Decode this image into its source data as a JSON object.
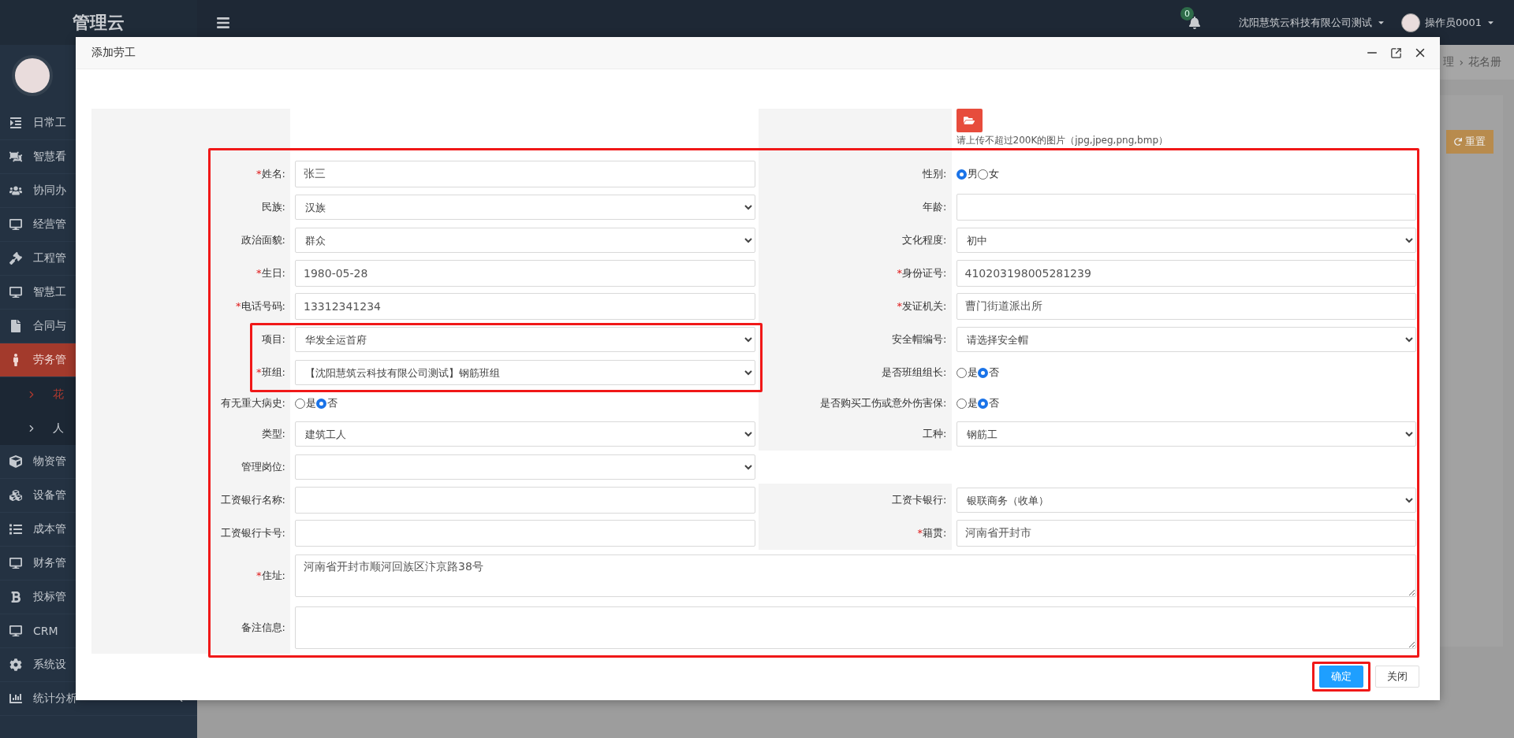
{
  "app": {
    "title": "管理云",
    "notifications": "0",
    "company": "沈阳慧筑云科技有限公司测试",
    "user": "操作员0001"
  },
  "sidebar": {
    "items": [
      {
        "label": "日常工",
        "selected": false
      },
      {
        "label": "智慧看",
        "selected": false
      },
      {
        "label": "协同办",
        "selected": false
      },
      {
        "label": "经营管",
        "selected": false
      },
      {
        "label": "工程管",
        "selected": false
      },
      {
        "label": "智慧工",
        "selected": false
      },
      {
        "label": "合同与",
        "selected": false
      },
      {
        "label": "劳务管",
        "selected": true,
        "children": [
          {
            "label": "花",
            "selected": true
          },
          {
            "label": "人",
            "selected": false
          }
        ]
      },
      {
        "label": "物资管",
        "selected": false
      },
      {
        "label": "设备管",
        "selected": false
      },
      {
        "label": "成本管",
        "selected": false
      },
      {
        "label": "财务管",
        "selected": false
      },
      {
        "label": "投标管",
        "selected": false
      },
      {
        "label": "CRM",
        "selected": false
      },
      {
        "label": "系统设",
        "selected": false
      },
      {
        "label": "统计分析",
        "selected": false
      }
    ]
  },
  "breadcrumb": {
    "items": [
      "理",
      "花名册"
    ],
    "separator": "›"
  },
  "reset_button": "重置",
  "dialog": {
    "title": "添加劳工",
    "upload_hint": "请上传不超过200K的图片（jpg,jpeg,png,bmp）",
    "rows": [
      [
        {
          "kind": "text",
          "label": "姓名:",
          "mark": "*",
          "value": "张三"
        },
        {
          "kind": "radio",
          "label": "性别:",
          "options": [
            {
              "label": "男",
              "selected": true
            },
            {
              "label": "女",
              "selected": false
            }
          ]
        }
      ],
      [
        {
          "kind": "select",
          "label": "民族:",
          "value": "汉族"
        },
        {
          "kind": "text",
          "label": "年龄:"
        }
      ],
      [
        {
          "kind": "select",
          "label": "政治面貌:",
          "value": "群众"
        },
        {
          "kind": "select",
          "label": "文化程度:",
          "value": "初中"
        }
      ],
      [
        {
          "kind": "text",
          "label": "生日:",
          "mark": "*",
          "value": "1980-05-28"
        },
        {
          "kind": "text",
          "label": "身份证号:",
          "mark": "*",
          "value": "410203198005281239"
        }
      ],
      [
        {
          "kind": "text",
          "label": "电话号码:",
          "mark": "*",
          "value": "13312341234"
        },
        {
          "kind": "text",
          "label": "发证机关:",
          "mark": "*",
          "value": "曹门街道派出所"
        }
      ],
      [
        {
          "kind": "select",
          "label": "项目:",
          "value": "华发全运首府"
        },
        {
          "kind": "select",
          "label": "安全帽编号:",
          "value": "请选择安全帽"
        }
      ],
      [
        {
          "kind": "select",
          "label": "班组:",
          "mark": "*",
          "value": "【沈阳慧筑云科技有限公司测试】钢筋班组"
        },
        {
          "kind": "radio",
          "label": "是否班组组长:",
          "options": [
            {
              "label": "是",
              "selected": false
            },
            {
              "label": "否",
              "selected": true
            }
          ]
        }
      ],
      [
        {
          "kind": "radio",
          "label": "有无重大病史:",
          "options": [
            {
              "label": "是",
              "selected": false
            },
            {
              "label": "否",
              "selected": true
            }
          ]
        },
        {
          "kind": "radio",
          "label": "是否购买工伤或意外伤害保:",
          "options": [
            {
              "label": "是",
              "selected": false
            },
            {
              "label": "否",
              "selected": true
            }
          ]
        }
      ],
      [
        {
          "kind": "select",
          "label": "类型:",
          "value": "建筑工人"
        },
        {
          "kind": "select",
          "label": "工种:",
          "value": "钢筋工"
        }
      ],
      [
        {
          "kind": "select",
          "label": "管理岗位:"
        }
      ],
      [
        {
          "kind": "text",
          "label": "工资银行名称:"
        },
        {
          "kind": "select",
          "label": "工资卡银行:",
          "value": "银联商务（收单）"
        }
      ],
      [
        {
          "kind": "text",
          "label": "工资银行卡号:"
        },
        {
          "kind": "text",
          "label": "籍贯:",
          "mark": "*",
          "value": "河南省开封市"
        }
      ],
      [
        {
          "kind": "textarea",
          "label": "住址:",
          "mark": "*",
          "value": "河南省开封市顺河回族区汴京路38号"
        }
      ],
      [
        {
          "kind": "textarea",
          "label": "备注信息:"
        }
      ]
    ],
    "buttons": [
      {
        "label": "确定",
        "kind": "primary"
      },
      {
        "label": "关闭",
        "kind": "default"
      }
    ]
  }
}
